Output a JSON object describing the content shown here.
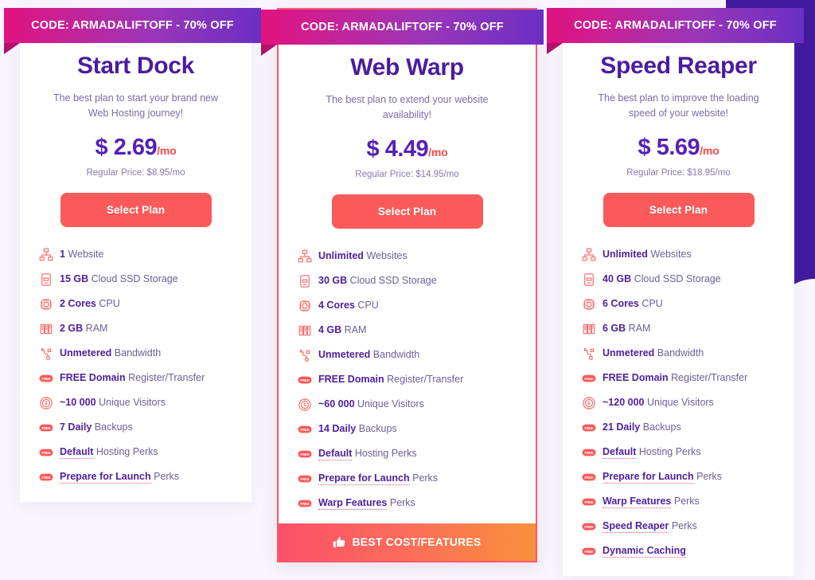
{
  "theme": {
    "background": "#f8f6fb",
    "accent_purple": "#4a1d9e",
    "accent_coral": "#fa5a5a",
    "ribbon_pink": "#e0127f",
    "ribbon_purple": "#6b2fc4",
    "deco_purple": "#431b9e"
  },
  "promo": {
    "ribbon_text": "CODE: ARMADALIFTOFF - 70% OFF"
  },
  "cta": {
    "select_plan": "Select Plan"
  },
  "best_banner": {
    "icon": "thumbs-up-icon",
    "label": "BEST COST/FEATURES"
  },
  "plans": [
    {
      "name": "Start Dock",
      "description": "The best plan to start your brand new Web Hosting journey!",
      "price": "$ 2.69",
      "period": "/mo",
      "regular_price": "Regular Price: $8.95/mo",
      "featured": false,
      "features": [
        {
          "icon": "sitemap-icon",
          "strong": "1",
          "rest": "Website",
          "dotted": false
        },
        {
          "icon": "ssd-drive-icon",
          "strong": "15 GB",
          "rest": "Cloud SSD Storage",
          "dotted": false
        },
        {
          "icon": "cpu-chip-icon",
          "strong": "2 Cores",
          "rest": "CPU",
          "dotted": false
        },
        {
          "icon": "ram-stick-icon",
          "strong": "2 GB",
          "rest": "RAM",
          "dotted": false
        },
        {
          "icon": "bandwidth-cable-icon",
          "strong": "Unmetered",
          "rest": "Bandwidth",
          "dotted": false
        },
        {
          "icon": "free-pill-icon",
          "strong": "FREE Domain",
          "rest": "Register/Transfer",
          "dotted": false
        },
        {
          "icon": "visitors-meter-icon",
          "strong": "~10 000",
          "rest": "Unique Visitors",
          "dotted": false
        },
        {
          "icon": "free-pill-icon",
          "strong": "7 Daily",
          "rest": "Backups",
          "dotted": false
        },
        {
          "icon": "free-pill-icon",
          "strong": "Default",
          "rest": "Hosting Perks",
          "dotted": true
        },
        {
          "icon": "free-pill-icon",
          "strong": "Prepare for Launch",
          "rest": "Perks",
          "dotted": true
        }
      ]
    },
    {
      "name": "Web Warp",
      "description": "The best plan to extend your website availability!",
      "price": "$ 4.49",
      "period": "/mo",
      "regular_price": "Regular Price: $14.95/mo",
      "featured": true,
      "features": [
        {
          "icon": "sitemap-icon",
          "strong": "Unlimited",
          "rest": "Websites",
          "dotted": false
        },
        {
          "icon": "ssd-drive-icon",
          "strong": "30 GB",
          "rest": "Cloud SSD Storage",
          "dotted": false
        },
        {
          "icon": "cpu-chip-icon",
          "strong": "4 Cores",
          "rest": "CPU",
          "dotted": false
        },
        {
          "icon": "ram-stick-icon",
          "strong": "4 GB",
          "rest": "RAM",
          "dotted": false
        },
        {
          "icon": "bandwidth-cable-icon",
          "strong": "Unmetered",
          "rest": "Bandwidth",
          "dotted": false
        },
        {
          "icon": "free-pill-icon",
          "strong": "FREE Domain",
          "rest": "Register/Transfer",
          "dotted": false
        },
        {
          "icon": "visitors-meter-icon",
          "strong": "~60 000",
          "rest": "Unique Visitors",
          "dotted": false
        },
        {
          "icon": "free-pill-icon",
          "strong": "14 Daily",
          "rest": "Backups",
          "dotted": false
        },
        {
          "icon": "free-pill-icon",
          "strong": "Default",
          "rest": "Hosting Perks",
          "dotted": true
        },
        {
          "icon": "free-pill-icon",
          "strong": "Prepare for Launch",
          "rest": "Perks",
          "dotted": true
        },
        {
          "icon": "free-pill-icon",
          "strong": "Warp Features",
          "rest": "Perks",
          "dotted": true
        }
      ]
    },
    {
      "name": "Speed Reaper",
      "description": "The best plan to improve the loading speed of your website!",
      "price": "$ 5.69",
      "period": "/mo",
      "regular_price": "Regular Price: $18.95/mo",
      "featured": false,
      "features": [
        {
          "icon": "sitemap-icon",
          "strong": "Unlimited",
          "rest": "Websites",
          "dotted": false
        },
        {
          "icon": "ssd-drive-icon",
          "strong": "40 GB",
          "rest": "Cloud SSD Storage",
          "dotted": false
        },
        {
          "icon": "cpu-chip-icon",
          "strong": "6 Cores",
          "rest": "CPU",
          "dotted": false
        },
        {
          "icon": "ram-stick-icon",
          "strong": "6 GB",
          "rest": "RAM",
          "dotted": false
        },
        {
          "icon": "bandwidth-cable-icon",
          "strong": "Unmetered",
          "rest": "Bandwidth",
          "dotted": false
        },
        {
          "icon": "free-pill-icon",
          "strong": "FREE Domain",
          "rest": "Register/Transfer",
          "dotted": false
        },
        {
          "icon": "visitors-meter-icon",
          "strong": "~120 000",
          "rest": "Unique Visitors",
          "dotted": false
        },
        {
          "icon": "free-pill-icon",
          "strong": "21 Daily",
          "rest": "Backups",
          "dotted": false
        },
        {
          "icon": "free-pill-icon",
          "strong": "Default",
          "rest": "Hosting Perks",
          "dotted": true
        },
        {
          "icon": "free-pill-icon",
          "strong": "Prepare for Launch",
          "rest": "Perks",
          "dotted": true
        },
        {
          "icon": "free-pill-icon",
          "strong": "Warp Features",
          "rest": "Perks",
          "dotted": true
        },
        {
          "icon": "free-pill-icon",
          "strong": "Speed Reaper",
          "rest": "Perks",
          "dotted": true
        },
        {
          "icon": "free-pill-icon",
          "strong": "Dynamic Caching",
          "rest": "",
          "dotted": true
        }
      ]
    }
  ]
}
